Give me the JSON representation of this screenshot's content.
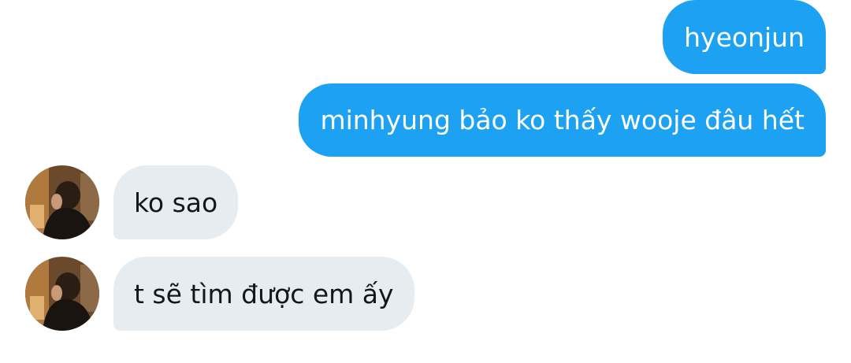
{
  "messages": [
    {
      "direction": "outgoing",
      "text": "hyeonjun"
    },
    {
      "direction": "outgoing",
      "text": "minhyung bảo ko thấy wooje đâu hết"
    },
    {
      "direction": "incoming",
      "text": "ko sao"
    },
    {
      "direction": "incoming",
      "text": "t sẽ tìm được em ấy"
    }
  ],
  "colors": {
    "outgoing_bubble": "#1da1f2",
    "outgoing_text": "#ffffff",
    "incoming_bubble": "#e6ecf0",
    "incoming_text": "#14171a"
  }
}
